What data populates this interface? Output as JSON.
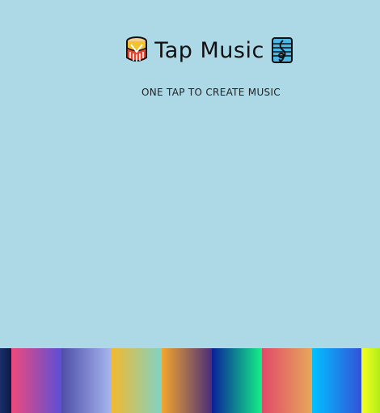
{
  "header": {
    "title": "Tap Music",
    "subtitle": "ONE TAP TO CREATE MUSIC",
    "left_icon": "drum-icon",
    "right_icon": "treble-clef-icon"
  },
  "colors": {
    "background": "#add8e6"
  },
  "pads": [
    {
      "name": "pad-1",
      "from": "#1a2f6b",
      "to": "#0b1a44"
    },
    {
      "name": "pad-2",
      "from": "#ef4a7b",
      "to": "#5b4fd6"
    },
    {
      "name": "pad-3",
      "from": "#4f4ea8",
      "to": "#a7b6ef"
    },
    {
      "name": "pad-4",
      "from": "#f3b92f",
      "to": "#7fd3c7"
    },
    {
      "name": "pad-5",
      "from": "#f3a72d",
      "to": "#4b2d7a"
    },
    {
      "name": "pad-6",
      "from": "#0a1f9a",
      "to": "#14f086"
    },
    {
      "name": "pad-7",
      "from": "#e14a69",
      "to": "#e6a85b"
    },
    {
      "name": "pad-8",
      "from": "#00c1ff",
      "to": "#3452d9"
    },
    {
      "name": "pad-9",
      "from": "#f4ff1e",
      "to": "#b3ee1a"
    }
  ]
}
